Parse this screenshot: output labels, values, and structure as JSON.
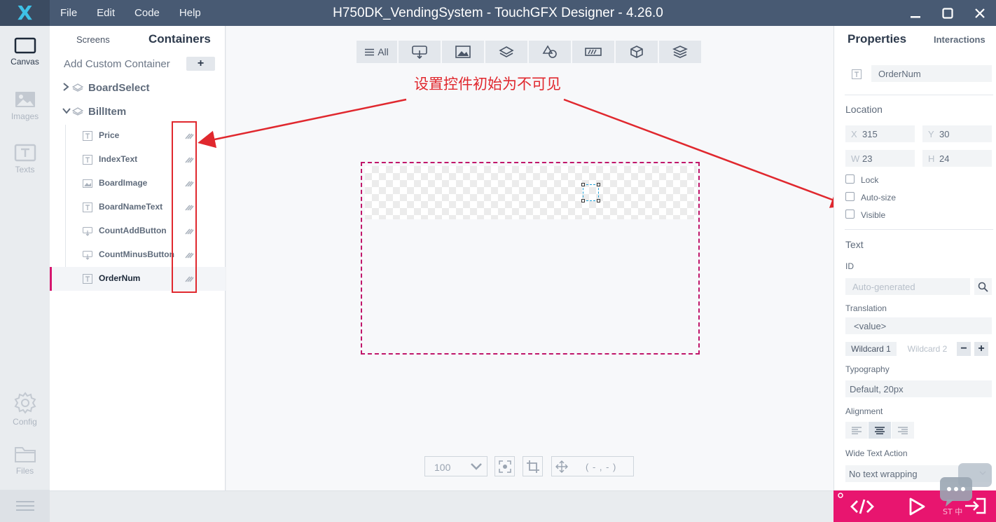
{
  "titlebar": {
    "logo": "X",
    "menu": [
      "File",
      "Edit",
      "Code",
      "Help"
    ],
    "title": "H750DK_VendingSystem - TouchGFX Designer - 4.26.0",
    "controls": [
      "minimize-icon",
      "maximize-icon",
      "close-icon"
    ]
  },
  "rail": {
    "items": [
      {
        "label": "Canvas",
        "icon": "canvas-icon",
        "active": true
      },
      {
        "label": "Images",
        "icon": "images-icon",
        "active": false
      },
      {
        "label": "Texts",
        "icon": "texts-icon",
        "active": false
      },
      {
        "label": "Config",
        "icon": "gear-icon",
        "active": false
      },
      {
        "label": "Files",
        "icon": "folder-icon",
        "active": false
      }
    ]
  },
  "tree": {
    "tab_screens": "Screens",
    "tab_containers": "Containers",
    "add_label": "Add Custom Container",
    "add_button": "+",
    "groups": [
      {
        "label": "BoardSelect",
        "expanded": false
      },
      {
        "label": "BillItem",
        "expanded": true
      }
    ],
    "children": [
      {
        "name": "Price",
        "icon": "text-icon"
      },
      {
        "name": "IndexText",
        "icon": "text-icon"
      },
      {
        "name": "BoardImage",
        "icon": "image-icon"
      },
      {
        "name": "BoardNameText",
        "icon": "text-icon"
      },
      {
        "name": "CountAddButton",
        "icon": "button-icon"
      },
      {
        "name": "CountMinusButton",
        "icon": "button-icon"
      },
      {
        "name": "OrderNum",
        "icon": "text-icon",
        "selected": true
      }
    ]
  },
  "canvas": {
    "toolbar_all": "All",
    "annotation": "设置控件初始为不可见",
    "zoom": "100",
    "coords": "( - , - )",
    "accent": "#c0166a"
  },
  "props": {
    "tab_properties": "Properties",
    "tab_interactions": "Interactions",
    "name": "OrderNum",
    "location_title": "Location",
    "x_label": "X",
    "x": "315",
    "y_label": "Y",
    "y": "30",
    "w_label": "W",
    "w": "23",
    "h_label": "H",
    "h": "24",
    "lock": "Lock",
    "autosize": "Auto-size",
    "visible": "Visible",
    "text_title": "Text",
    "id_label": "ID",
    "id_placeholder": "Auto-generated",
    "translation_label": "Translation",
    "translation_value": "<value>",
    "wildcard1": "Wildcard 1",
    "wildcard2": "Wildcard 2",
    "minus": "−",
    "plus": "+",
    "typography_label": "Typography",
    "typography_value": "Default, 20px",
    "alignment_label": "Alignment",
    "wide_text_label": "Wide Text Action",
    "wide_text_value": "No text wrapping"
  },
  "runbar": {
    "color": "#e8156f",
    "chat_text": "ST 中"
  }
}
